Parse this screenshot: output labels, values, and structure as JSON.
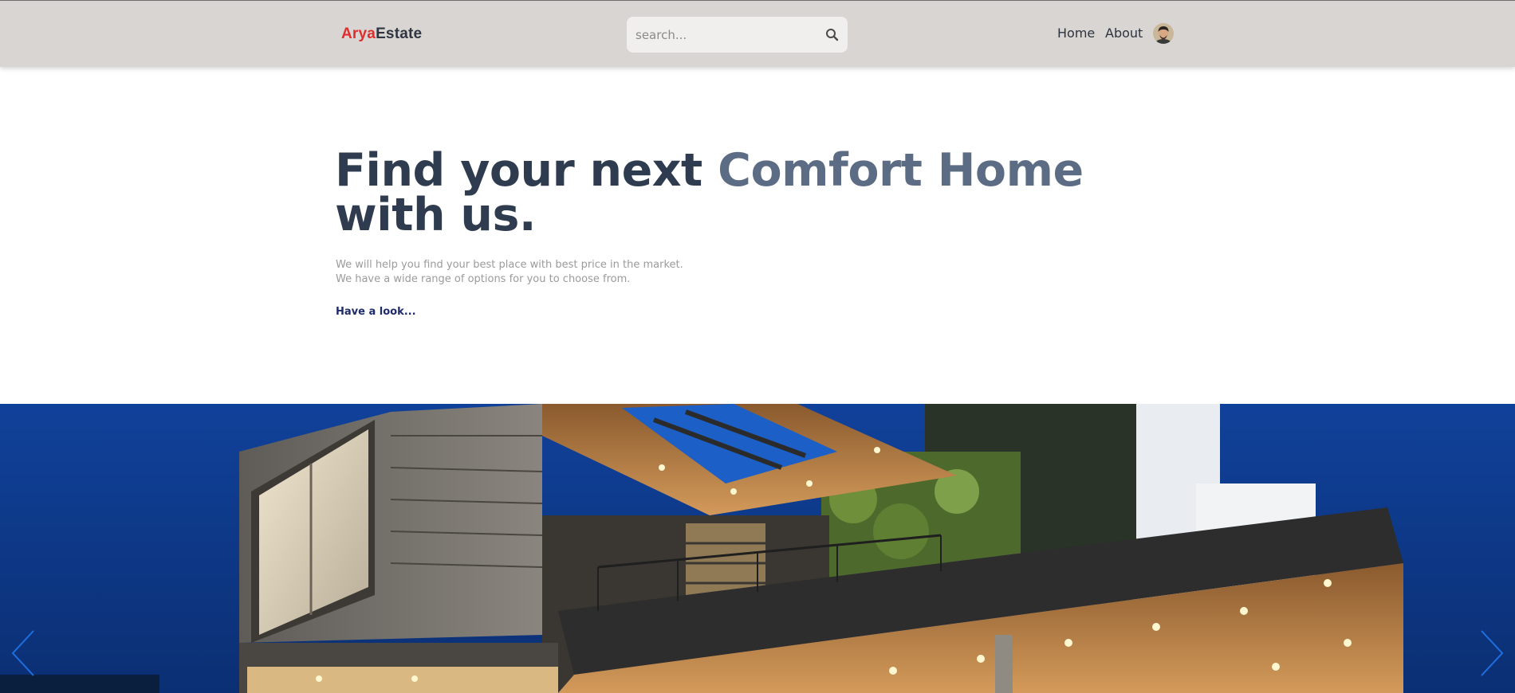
{
  "header": {
    "logo_part1": "Arya",
    "logo_part2": "Estate",
    "search_placeholder": "search...",
    "nav": {
      "home": "Home",
      "about": "About"
    },
    "search_icon": "search-icon",
    "avatar_icon": "user-avatar"
  },
  "hero": {
    "title_part1": "Find your next ",
    "title_accent": "Comfort Home",
    "title_part2": "with us.",
    "subtitle_line1": "We will help you find your best place with best price in the market.",
    "subtitle_line2": "We have a wide range of options for you to choose from.",
    "cta": "Have a look..."
  },
  "carousel": {
    "prev_icon": "chevron-left-icon",
    "next_icon": "chevron-right-icon"
  },
  "colors": {
    "header_bg": "#d9d5d2",
    "logo_accent": "#e02d2d",
    "title": "#2f3c4f",
    "title_accent": "#5c6c84",
    "cta": "#1e2b6a",
    "carousel_arrow": "#1f6fe0"
  }
}
